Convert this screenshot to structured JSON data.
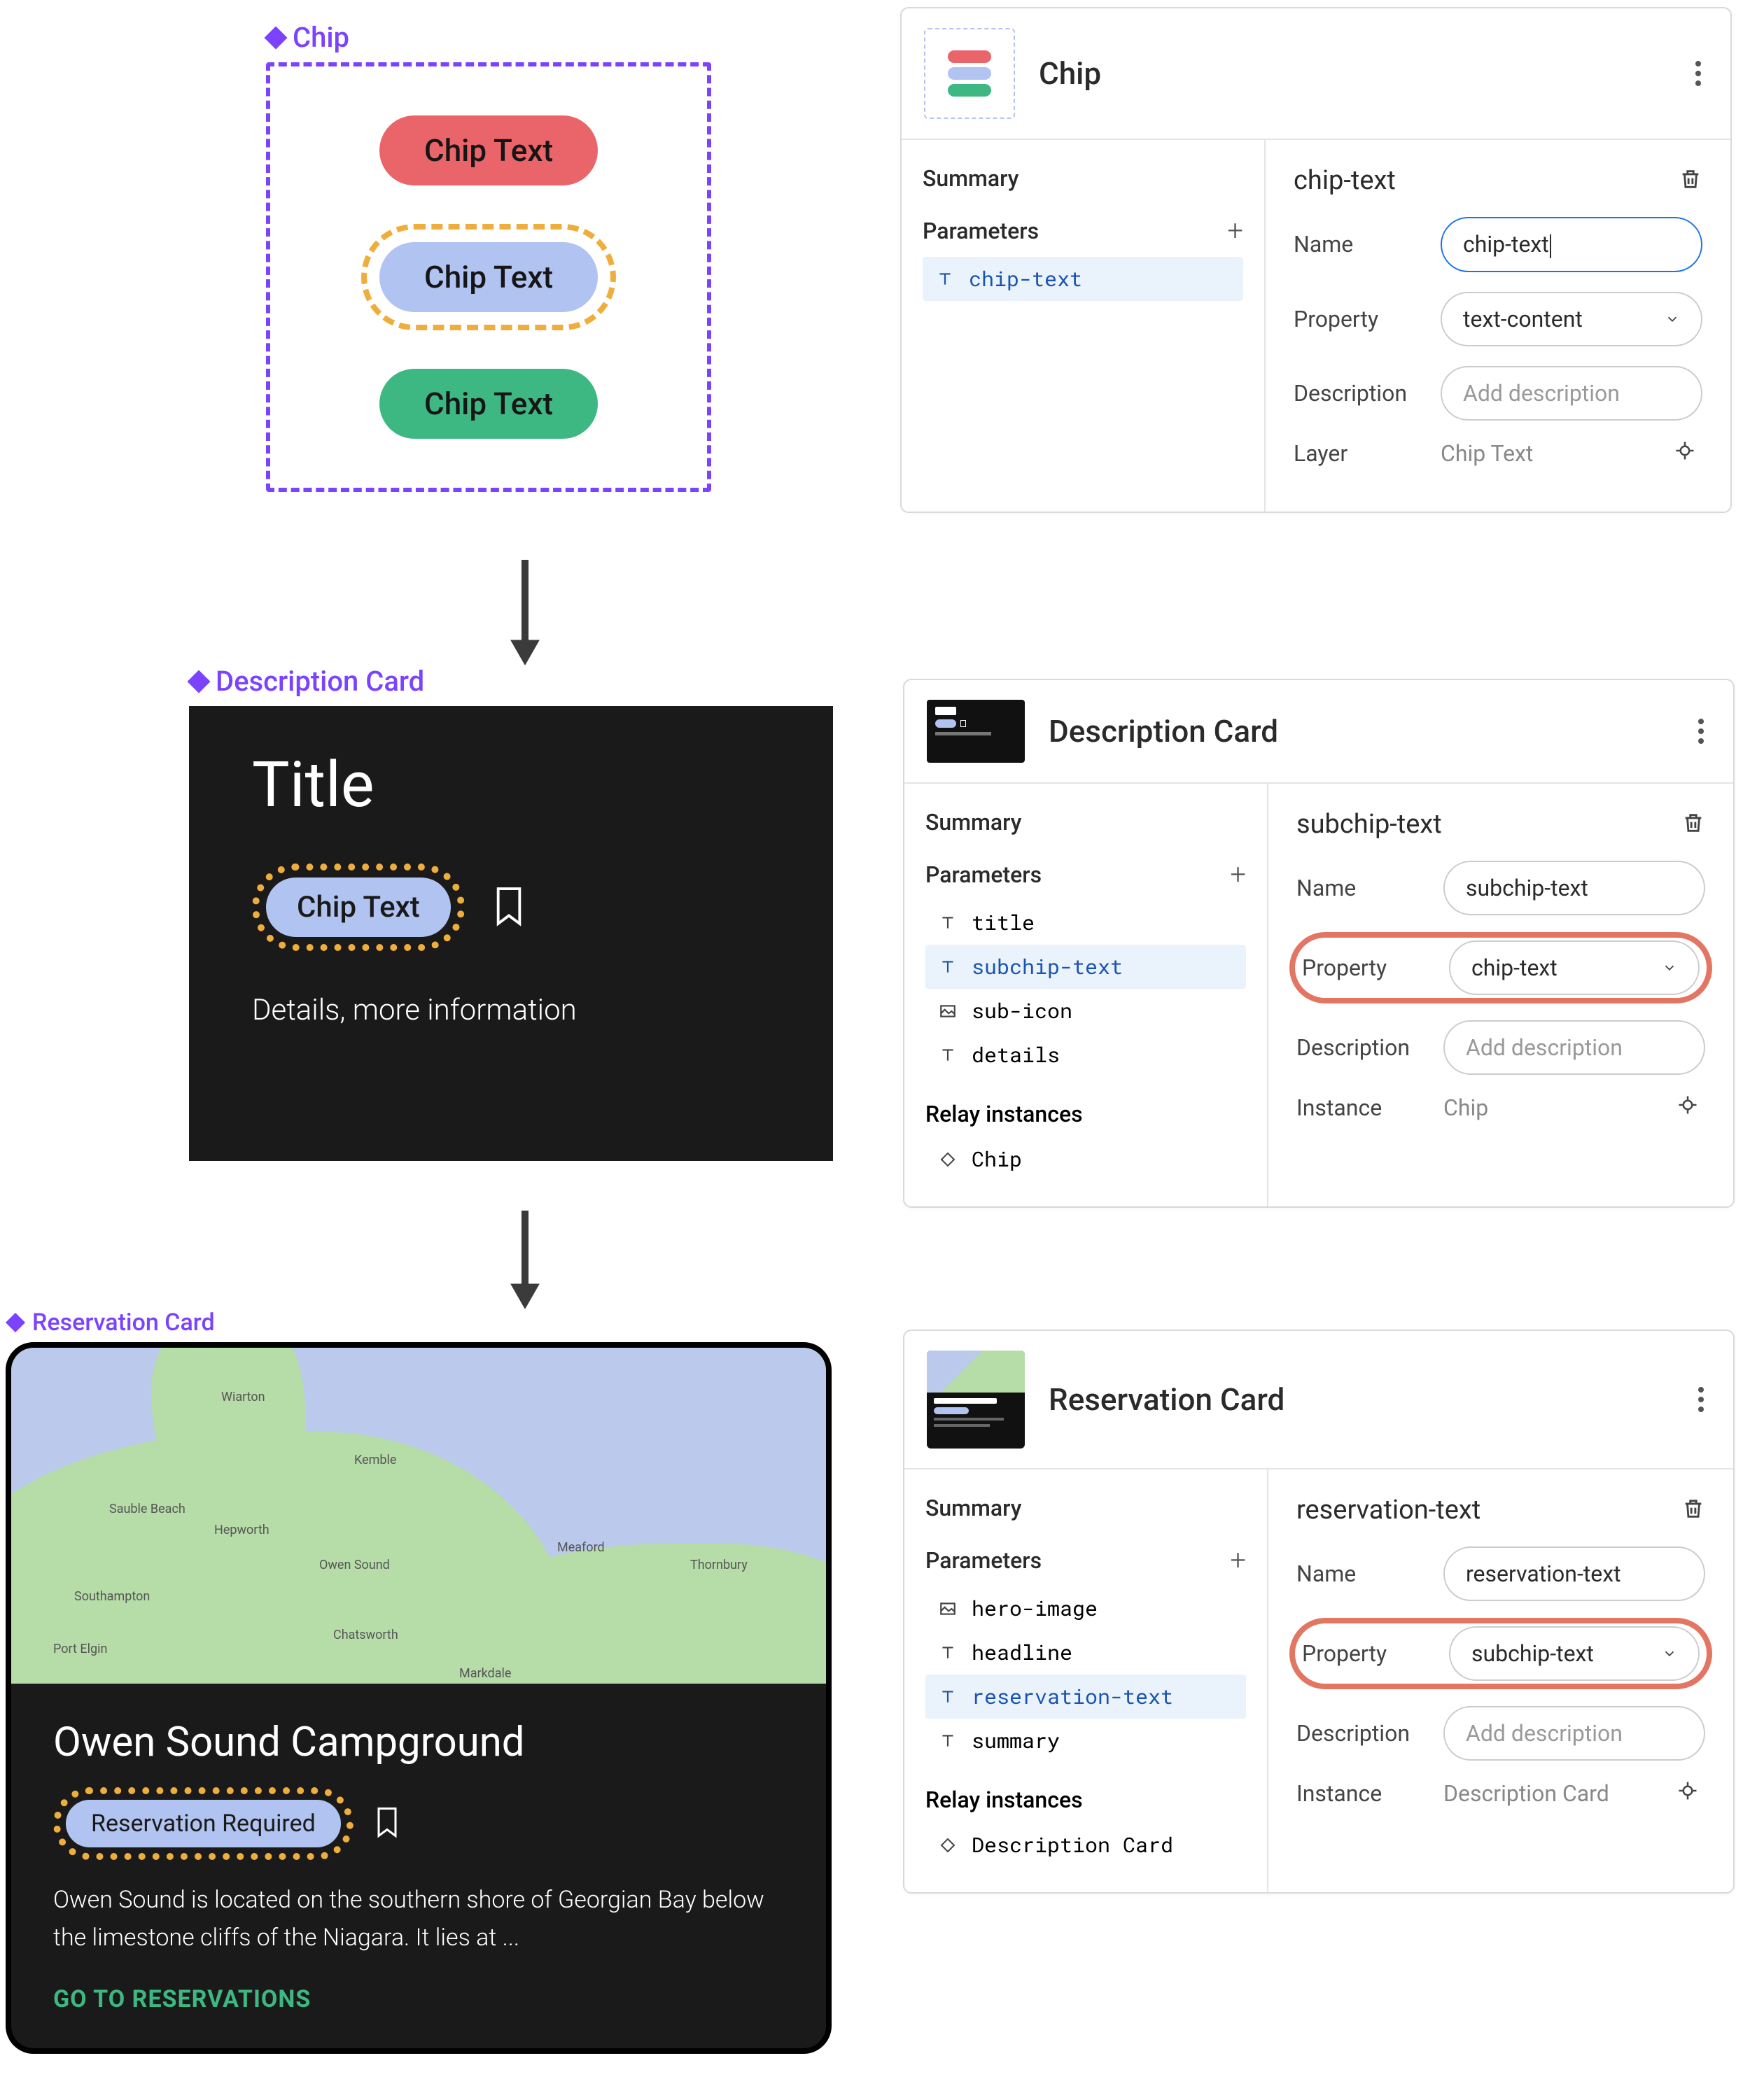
{
  "left": {
    "chip": {
      "label": "Chip",
      "variants": [
        "Chip Text",
        "Chip Text",
        "Chip Text"
      ]
    },
    "desc": {
      "label": "Description Card",
      "title": "Title",
      "chip_text": "Chip Text",
      "details": "Details, more information"
    },
    "res": {
      "label": "Reservation Card",
      "headline": "Owen Sound Campground",
      "chip_text": "Reservation Required",
      "summary": "Owen Sound is located on the southern shore of Georgian Bay below the limestone cliffs of the Niagara. It lies at ...",
      "action": "GO TO RESERVATIONS",
      "map_places": [
        "Wiarton",
        "Kemble",
        "Sauble Beach",
        "Hepworth",
        "Owen Sound",
        "Meaford",
        "Southampton",
        "Chatsworth",
        "Thornbury",
        "Port Elgin",
        "Markdale"
      ]
    }
  },
  "panels": {
    "common": {
      "summary_label": "Summary",
      "parameters_label": "Parameters",
      "relay_label": "Relay instances",
      "name_label": "Name",
      "property_label": "Property",
      "description_label": "Description",
      "description_placeholder": "Add description",
      "layer_label": "Layer",
      "instance_label": "Instance"
    },
    "chip": {
      "title": "Chip",
      "params": [
        "chip-text"
      ],
      "active_param": "chip-text",
      "right": {
        "title": "chip-text",
        "name_value": "chip-text",
        "property_value": "text-content",
        "layer_value": "Chip Text"
      }
    },
    "desc": {
      "title": "Description Card",
      "params": [
        "title",
        "subchip-text",
        "sub-icon",
        "details"
      ],
      "active_param": "subchip-text",
      "relay": [
        "Chip"
      ],
      "right": {
        "title": "subchip-text",
        "name_value": "subchip-text",
        "property_value": "chip-text",
        "instance_value": "Chip"
      }
    },
    "res": {
      "title": "Reservation Card",
      "params": [
        "hero-image",
        "headline",
        "reservation-text",
        "summary"
      ],
      "active_param": "reservation-text",
      "relay": [
        "Description Card"
      ],
      "right": {
        "title": "reservation-text",
        "name_value": "reservation-text",
        "property_value": "subchip-text",
        "instance_value": "Description Card"
      }
    }
  }
}
